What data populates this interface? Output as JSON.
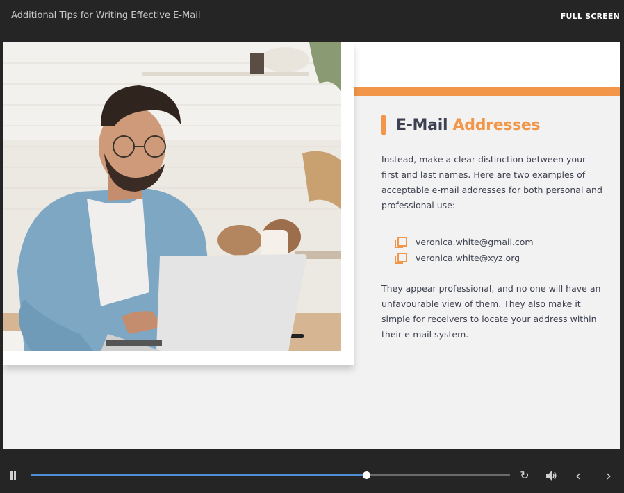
{
  "header": {
    "title": "Additional Tips for Writing Effective E-Mail",
    "fullscreen_label": "FULL SCREEN"
  },
  "slide": {
    "heading_main": "E-Mail",
    "heading_accent": "Addresses",
    "paragraph1": "Instead, make a clear distinction between your first and last names. Here are two examples of acceptable e-mail addresses for both personal and professional use:",
    "emails": [
      "veronica.white@gmail.com",
      "veronica.white@xyz.org"
    ],
    "paragraph2": "They appear professional, and no one will have an unfavourable view of them. They also make it simple for receivers to locate your address within their e-mail system.",
    "accent_color": "#f2964a"
  },
  "player": {
    "progress": 0.7,
    "icons": {
      "pause": "pause-icon",
      "replay": "replay-icon",
      "volume": "volume-icon",
      "prev": "chevron-left-icon",
      "next": "chevron-right-icon"
    }
  }
}
